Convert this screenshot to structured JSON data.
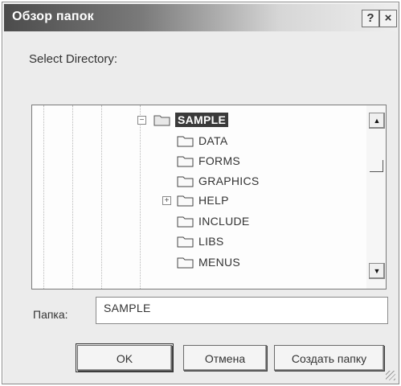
{
  "window": {
    "title": "Обзор папок",
    "help_glyph": "?",
    "close_glyph": "×"
  },
  "prompt": "Select Directory:",
  "tree": {
    "selected": "SAMPLE",
    "items": [
      {
        "label": "SAMPLE",
        "icon": "folder-icon",
        "expander": "−"
      },
      {
        "label": "DATA",
        "icon": "folder-icon"
      },
      {
        "label": "FORMS",
        "icon": "folder-icon"
      },
      {
        "label": "GRAPHICS",
        "icon": "folder-icon"
      },
      {
        "label": "HELP",
        "icon": "folder-icon",
        "expander": "+"
      },
      {
        "label": "INCLUDE",
        "icon": "folder-icon"
      },
      {
        "label": "LIBS",
        "icon": "folder-icon"
      },
      {
        "label": "MENUS",
        "icon": "folder-icon"
      }
    ],
    "scroll_up_glyph": "▲",
    "scroll_down_glyph": "▼"
  },
  "folder_field": {
    "label": "Папка:",
    "value": "SAMPLE"
  },
  "buttons": {
    "ok": "OK",
    "cancel": "Отмена",
    "new_folder": "Создать папку"
  }
}
